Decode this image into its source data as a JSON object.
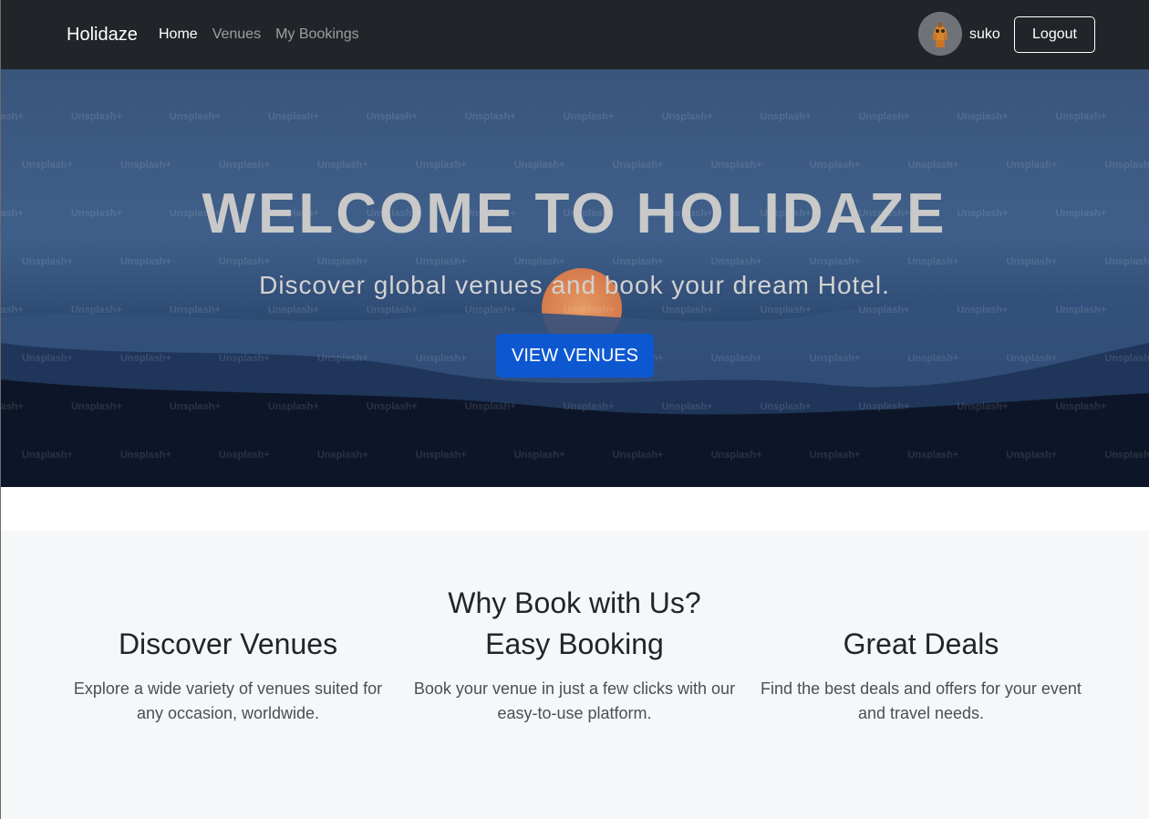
{
  "navbar": {
    "brand": "Holidaze",
    "links": [
      {
        "label": "Home",
        "active": true
      },
      {
        "label": "Venues",
        "active": false
      },
      {
        "label": "My Bookings",
        "active": false
      }
    ],
    "username": "suko",
    "logout_label": "Logout",
    "avatar_icon": "avatar-figure-icon"
  },
  "hero": {
    "title": "WELCOME TO HOLIDAZE",
    "subtitle": "Discover global venues and book your dream Hotel.",
    "cta_label": "VIEW VENUES",
    "watermark": "Unsplash+"
  },
  "features": {
    "title": "Why Book with Us?",
    "items": [
      {
        "title": "Discover Venues",
        "text": "Explore a wide variety of venues suited for any occasion, worldwide."
      },
      {
        "title": "Easy Booking",
        "text": "Book your venue in just a few clicks with our easy-to-use platform."
      },
      {
        "title": "Great Deals",
        "text": "Find the best deals and offers for your event and travel needs."
      }
    ]
  },
  "colors": {
    "navbar_bg": "#212529",
    "primary_button": "#0d58d1",
    "features_bg": "#f6f7f9"
  }
}
